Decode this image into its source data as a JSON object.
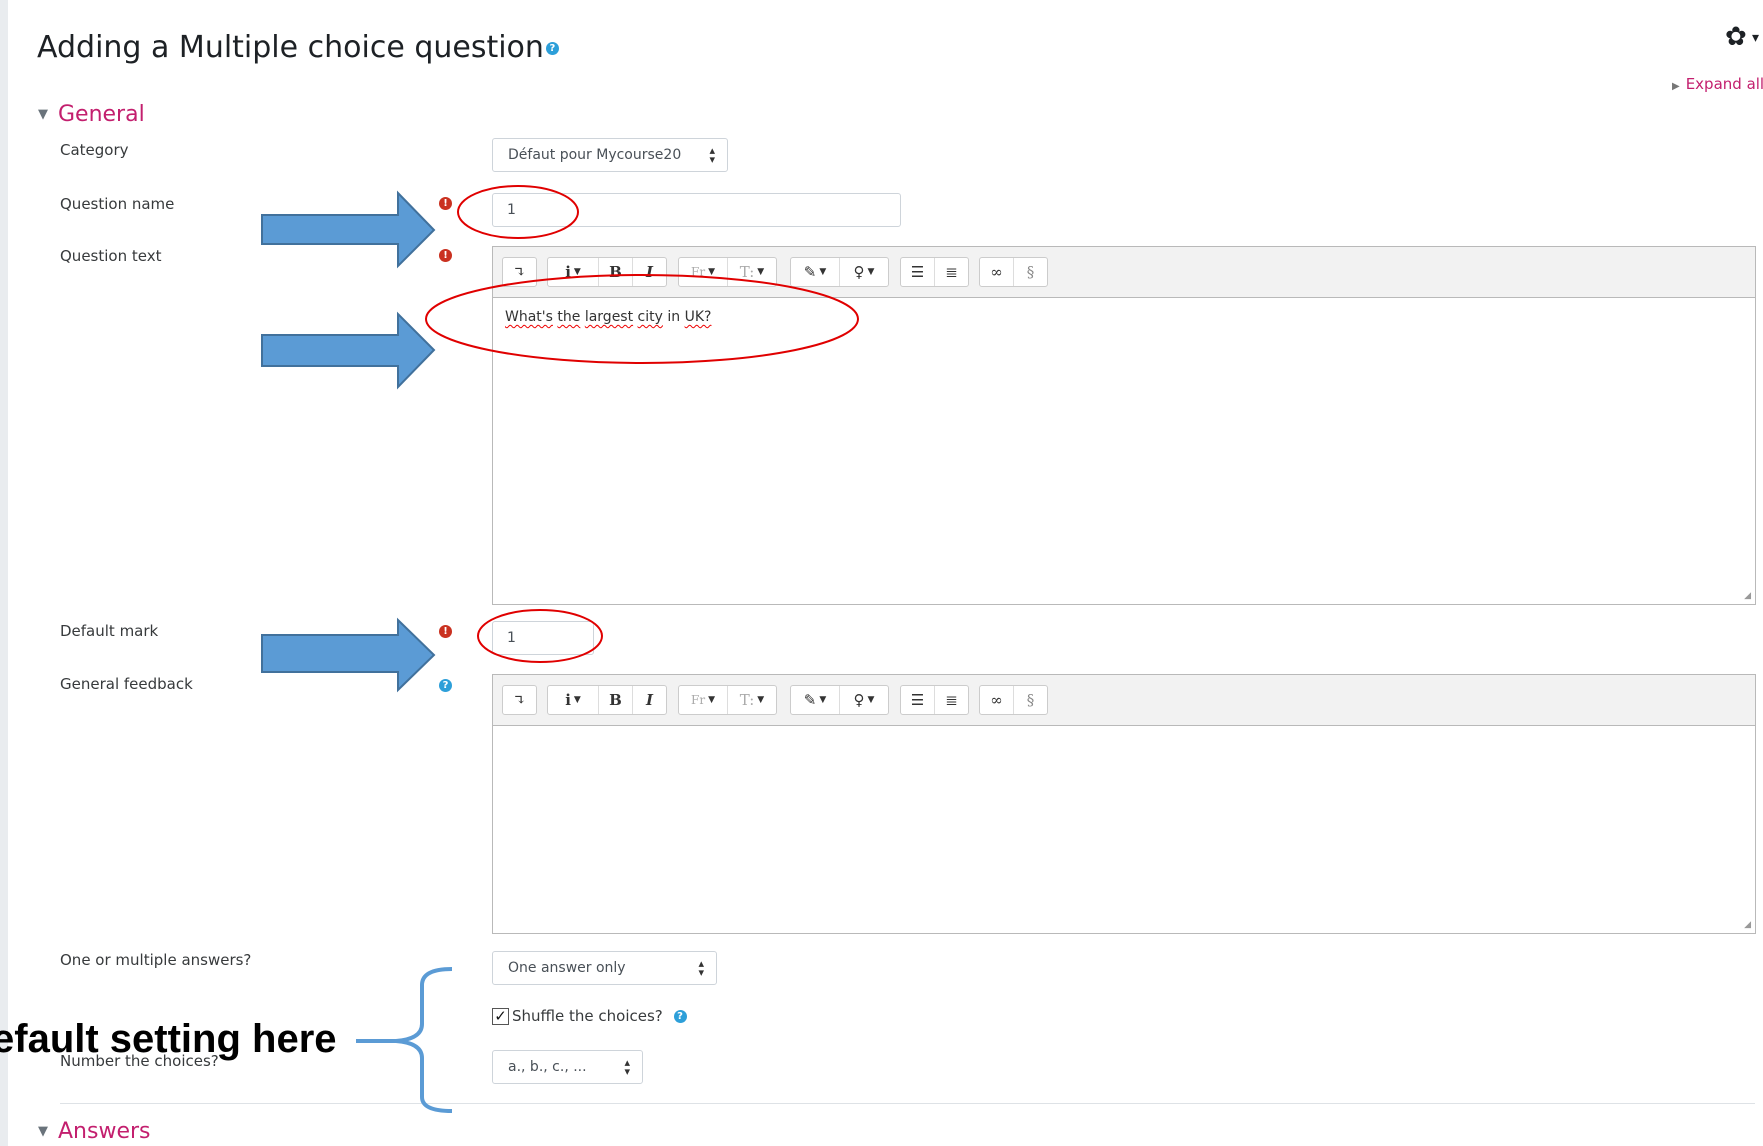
{
  "page": {
    "title": "Adding a Multiple choice question",
    "help_glyph": "?",
    "settings_caret": "▾",
    "expand_all": "Expand all"
  },
  "sections": {
    "general": "General",
    "answers": "Answers"
  },
  "fields": {
    "category": {
      "label": "Category",
      "value": "Défaut pour Mycourse20"
    },
    "question_name": {
      "label": "Question name",
      "value": "1"
    },
    "question_text": {
      "label": "Question text",
      "content_words": [
        "What's",
        "the",
        "largest",
        "city",
        "in",
        "UK?"
      ]
    },
    "default_mark": {
      "label": "Default mark",
      "value": "1"
    },
    "general_feedback": {
      "label": "General feedback",
      "content": ""
    },
    "one_or_multiple": {
      "label": "One or multiple answers?",
      "value": "One answer only"
    },
    "shuffle": {
      "label": "Shuffle the choices?",
      "checked": true
    },
    "number_choices": {
      "label": "Number the choices?",
      "value": "a., b., c., ..."
    }
  },
  "required_glyph": "!",
  "editor_toolbar": {
    "groups": [
      [
        "collapse-icon"
      ],
      [
        "info-style-icon",
        "bold-icon",
        "italic-icon"
      ],
      [
        "font-family-icon",
        "font-size-icon"
      ],
      [
        "font-color-icon",
        "highlight-icon"
      ],
      [
        "unordered-list-icon",
        "ordered-list-icon"
      ],
      [
        "link-icon",
        "unlink-icon"
      ]
    ]
  },
  "annotation": {
    "callout_text": "efault setting here",
    "arrow_color": "#5b9bd5",
    "circle_color": "#e00000"
  },
  "colors": {
    "accent": "#c31f6e",
    "required": "#ca3120",
    "help": "#2d9fd9"
  }
}
